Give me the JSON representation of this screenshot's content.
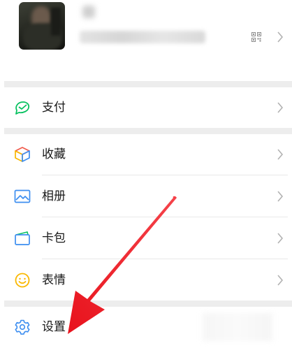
{
  "menu": {
    "pay": "支付",
    "favorites": "收藏",
    "album": "相册",
    "cards": "卡包",
    "stickers": "表情",
    "settings": "设置"
  },
  "colors": {
    "pay_icon": "#07c160",
    "annotation_arrow": "#f0202a",
    "separator": "#ededed"
  },
  "icons": {
    "pay": "pay-icon",
    "favorites": "cube-icon",
    "album": "image-icon",
    "cards": "card-wallet-icon",
    "stickers": "smiley-icon",
    "settings": "gear-icon",
    "qr": "qr-code-icon",
    "chevron": "chevron-right-icon"
  }
}
